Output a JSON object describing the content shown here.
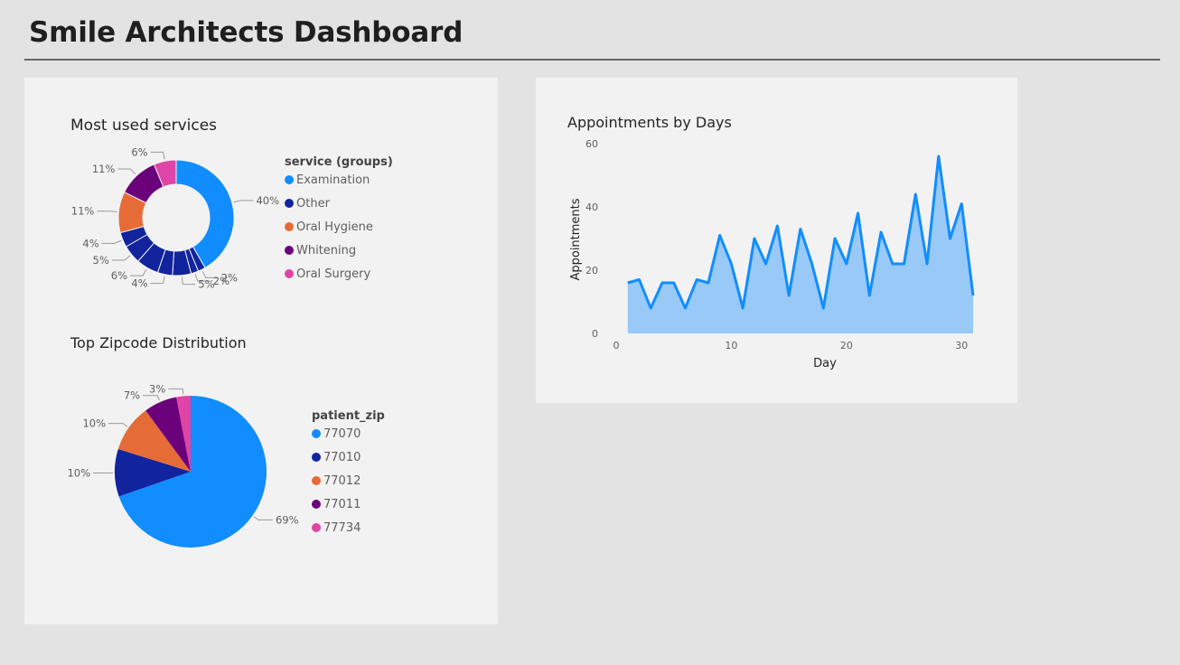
{
  "page": {
    "title": "Smile Architects Dashboard"
  },
  "colors": {
    "blue": "#118dff",
    "navy": "#12239e",
    "orange": "#e66c37",
    "purple": "#6b007b",
    "pink": "#e044a7",
    "area_fill": "#98c9f7",
    "card_bg": "#f2f2f2",
    "page_bg": "#e3e3e3"
  },
  "chart_data": [
    {
      "type": "pie",
      "variant": "donut",
      "title": "Most used services",
      "legend_title": "service (groups)",
      "legend_position": "right",
      "legend": [
        {
          "label": "Examination",
          "color": "#118dff"
        },
        {
          "label": "Other",
          "color": "#12239e"
        },
        {
          "label": "Oral Hygiene",
          "color": "#e66c37"
        },
        {
          "label": "Whitening",
          "color": "#6b007b"
        },
        {
          "label": "Oral Surgery",
          "color": "#e044a7"
        }
      ],
      "slices": [
        {
          "group": "Examination",
          "value": 40,
          "label": "40%"
        },
        {
          "group": "Other",
          "value": 2,
          "label": "2%"
        },
        {
          "group": "Other",
          "value": 2,
          "label": "2%"
        },
        {
          "group": "Other",
          "value": 5,
          "label": "5%"
        },
        {
          "group": "Other",
          "value": 4,
          "label": "4%"
        },
        {
          "group": "Other",
          "value": 6,
          "label": "6%"
        },
        {
          "group": "Other",
          "value": 5,
          "label": "5%"
        },
        {
          "group": "Other",
          "value": 4,
          "label": "4%"
        },
        {
          "group": "Oral Hygiene",
          "value": 11,
          "label": "11%"
        },
        {
          "group": "Whitening",
          "value": 11,
          "label": "11%"
        },
        {
          "group": "Oral Surgery",
          "value": 6,
          "label": "6%"
        }
      ]
    },
    {
      "type": "pie",
      "title": "Top Zipcode Distribution",
      "legend_title": "patient_zip",
      "legend_position": "right",
      "legend": [
        {
          "label": "77070",
          "color": "#118dff"
        },
        {
          "label": "77010",
          "color": "#12239e"
        },
        {
          "label": "77012",
          "color": "#e66c37"
        },
        {
          "label": "77011",
          "color": "#6b007b"
        },
        {
          "label": "77734",
          "color": "#e044a7"
        }
      ],
      "slices": [
        {
          "group": "77070",
          "value": 69,
          "label": "69%"
        },
        {
          "group": "77010",
          "value": 10,
          "label": "10%"
        },
        {
          "group": "77012",
          "value": 10,
          "label": "10%"
        },
        {
          "group": "77011",
          "value": 7,
          "label": "7%"
        },
        {
          "group": "77734",
          "value": 3,
          "label": "3%"
        }
      ]
    },
    {
      "type": "area",
      "title": "Appointments by Days",
      "xlabel": "Day",
      "ylabel": "Appointments",
      "xlim": [
        0,
        31
      ],
      "ylim": [
        0,
        60
      ],
      "x_ticks": [
        0,
        10,
        20,
        30
      ],
      "y_ticks": [
        0,
        20,
        40,
        60
      ],
      "grid": false,
      "x": [
        1,
        2,
        3,
        4,
        5,
        6,
        7,
        8,
        9,
        10,
        11,
        12,
        13,
        14,
        15,
        16,
        17,
        18,
        19,
        20,
        21,
        22,
        23,
        24,
        25,
        26,
        27,
        28,
        29,
        30,
        31
      ],
      "y": [
        16,
        17,
        8,
        16,
        16,
        8,
        17,
        16,
        31,
        22,
        8,
        30,
        22,
        34,
        12,
        33,
        22,
        8,
        30,
        22,
        38,
        12,
        32,
        22,
        22,
        44,
        22,
        56,
        30,
        41,
        12
      ]
    }
  ]
}
